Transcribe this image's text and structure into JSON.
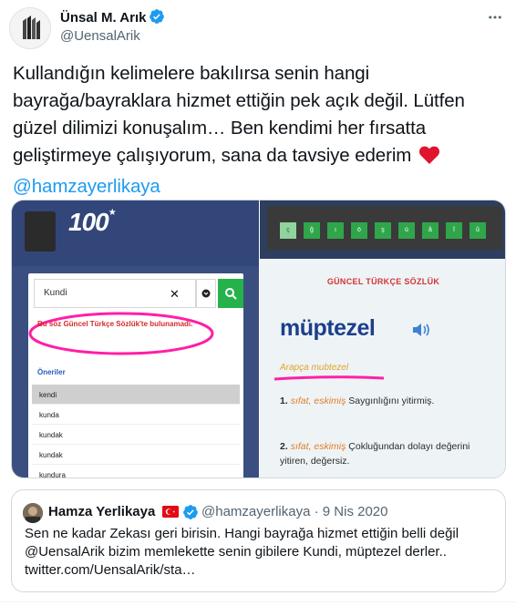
{
  "author": {
    "name": "Ünsal M. Arık",
    "handle": "@UensalArik",
    "verified": true
  },
  "tweet": {
    "text": "Kullandığın kelimelere bakılırsa senin hangi bayrağa/bayraklara hizmet ettiğin pek açık değil. Lütfen güzel dilimizi konuşalım… Ben kendimi her fırsatta geliştirmeye çalışıyorum, sana da tavsiye ederim",
    "mention": "@hamzayerlikaya",
    "emoji": "heart-icon"
  },
  "media": {
    "left": {
      "logo_text": "100",
      "search_value": "Kundi",
      "not_found": "Bu söz Güncel Türkçe Sözlük'te bulunamadı.",
      "suggestions_title": "Öneriler",
      "suggestions": [
        "kendi",
        "kunda",
        "kundak",
        "kundak",
        "kundura"
      ]
    },
    "right": {
      "keys": [
        "ç",
        "ğ",
        "ı",
        "ö",
        "ş",
        "ü",
        "â",
        "î",
        "û"
      ],
      "dictionary_title": "GÜNCEL TÜRKÇE SÖZLÜK",
      "word": "müptezel",
      "origin": "Arapça mubtezel",
      "definitions": [
        {
          "num": "1.",
          "tags": "sıfat, eskimiş",
          "text": "Saygınlığını yitirmiş."
        },
        {
          "num": "2.",
          "tags": "sıfat, eskimiş",
          "text": "Çokluğundan dolayı değerini yitiren, değersiz."
        }
      ]
    }
  },
  "quote": {
    "name": "Hamza Yerlikaya",
    "handle": "@hamzayerlikaya",
    "date": "· 9 Nis 2020",
    "text": "Sen ne kadar Zekası geri birisin. Hangi bayrağa hizmet ettiğin belli değil @UensalArik bizim memlekette senin gibilere Kundi, müptezel derler.. twitter.com/UensalArik/sta…"
  },
  "colors": {
    "link": "#1d9bf0",
    "secondary_text": "#536471",
    "border": "#cfd9de"
  }
}
